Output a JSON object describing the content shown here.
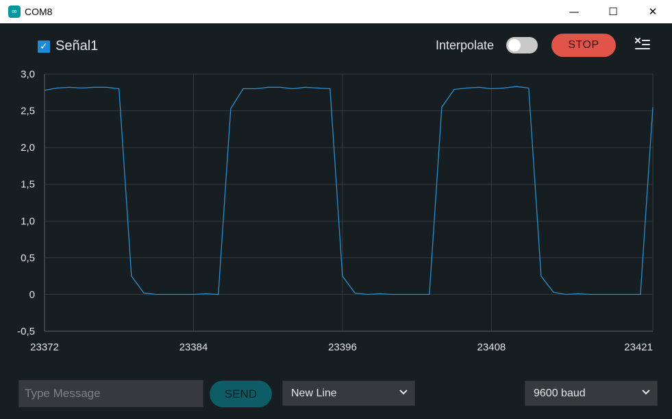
{
  "window": {
    "title": "COM8",
    "minimize": "—",
    "maximize": "☐",
    "close": "✕"
  },
  "toolbar": {
    "series_checked": "✓",
    "series_label": "Señal1",
    "interpolate_label": "Interpolate",
    "stop_label": "STOP"
  },
  "footer": {
    "message_placeholder": "Type Message",
    "send_label": "SEND",
    "line_ending": "New Line",
    "baud": "9600 baud"
  },
  "colors": {
    "line": "#2a8fd0",
    "grid": "#343b3f",
    "axis": "#e6e6e6"
  },
  "chart_data": {
    "type": "line",
    "x_ticks": [
      23372,
      23384,
      23396,
      23408,
      23421
    ],
    "y_ticks": [
      "3,0",
      "2,5",
      "2,0",
      "1,5",
      "1,0",
      "0,5",
      "0",
      "-0,5"
    ],
    "ylim": [
      -0.5,
      3.0
    ],
    "xlim": [
      23372,
      23421
    ],
    "grid": true,
    "series": [
      {
        "x": [
          23372,
          23373,
          23374,
          23375,
          23376,
          23377,
          23378,
          23379,
          23380,
          23381,
          23382,
          23383,
          23384,
          23385,
          23386,
          23387,
          23388,
          23389,
          23390,
          23391,
          23392,
          23393,
          23394,
          23395,
          23396,
          23397,
          23398,
          23399,
          23400,
          23401,
          23402,
          23403,
          23404,
          23405,
          23406,
          23407,
          23408,
          23409,
          23410,
          23411,
          23412,
          23413,
          23414,
          23415,
          23416,
          23417,
          23418,
          23419,
          23420,
          23421
        ],
        "y": [
          2.78,
          2.81,
          2.82,
          2.81,
          2.82,
          2.82,
          2.8,
          0.25,
          0.02,
          0.0,
          0.0,
          0.0,
          0.0,
          0.01,
          0.0,
          2.53,
          2.8,
          2.8,
          2.82,
          2.82,
          2.8,
          2.82,
          2.81,
          2.8,
          0.25,
          0.02,
          0.0,
          0.01,
          0.0,
          0.0,
          0.0,
          0.0,
          2.55,
          2.79,
          2.81,
          2.82,
          2.8,
          2.81,
          2.83,
          2.81,
          0.25,
          0.03,
          0.0,
          0.01,
          0.0,
          0.0,
          0.0,
          0.0,
          0.0,
          2.55
        ]
      }
    ]
  }
}
